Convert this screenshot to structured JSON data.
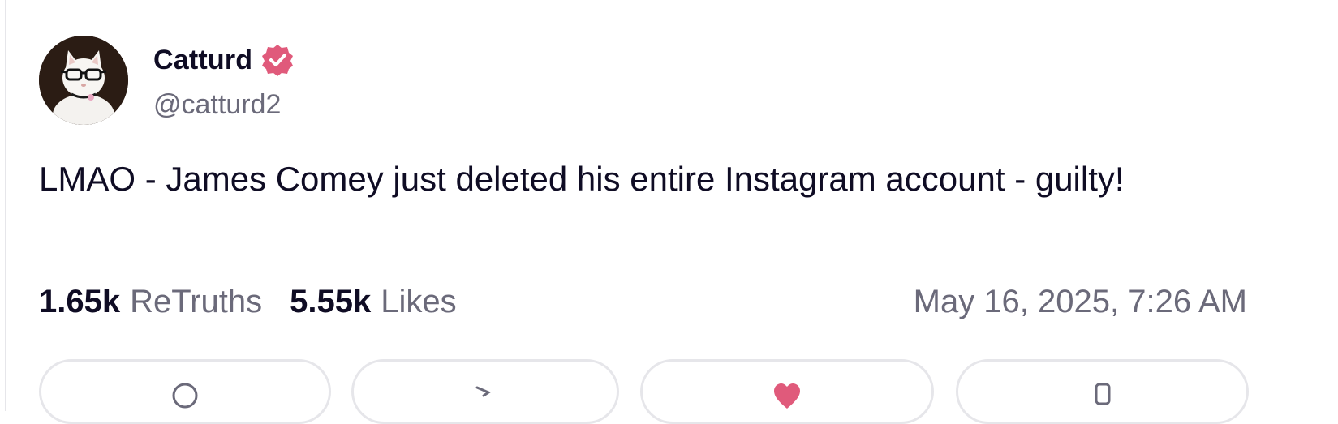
{
  "post": {
    "author": {
      "display_name": "Catturd",
      "handle": "@catturd2",
      "verified": true,
      "avatar": "white-cat-with-glasses"
    },
    "text": "LMAO - James Comey just deleted his entire Instagram account - guilty!",
    "stats": {
      "retruths_count": "1.65k",
      "retruths_label": "ReTruths",
      "likes_count": "5.55k",
      "likes_label": "Likes"
    },
    "timestamp": "May 16, 2025, 7:26 AM"
  },
  "actions": [
    {
      "name": "reply",
      "icon": "reply-icon"
    },
    {
      "name": "retruth",
      "icon": "retruth-icon"
    },
    {
      "name": "like",
      "icon": "heart-icon"
    },
    {
      "name": "share",
      "icon": "share-icon"
    }
  ],
  "colors": {
    "text_primary": "#0f0c24",
    "text_secondary": "#6b6a7a",
    "verified_badge": "#e05a7b",
    "heart": "#e05a7b",
    "border": "#e6e6ea"
  }
}
